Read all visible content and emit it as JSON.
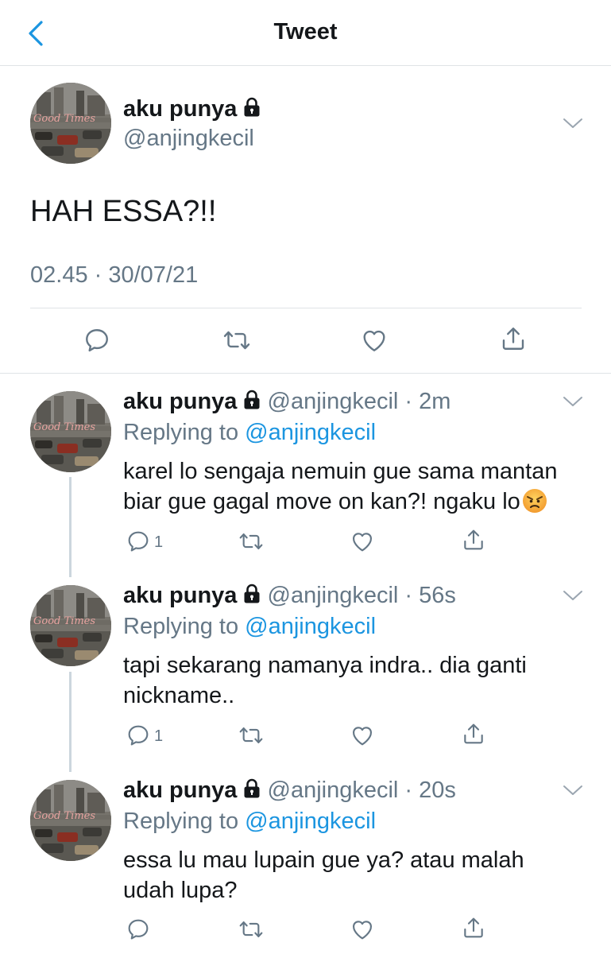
{
  "header": {
    "title": "Tweet"
  },
  "main_tweet": {
    "name": "aku punya",
    "handle": "@anjingkecil",
    "text": "HAH ESSA?!!",
    "timestamp": "02.45 · 30/07/21"
  },
  "replies": [
    {
      "name": "aku punya",
      "handle": "@anjingkecil",
      "time": "2m",
      "replying_prefix": "Replying to",
      "replying_handle": "@anjingkecil",
      "text_line1": "karel lo sengaja nemuin gue sama mantan",
      "text_line2": "biar gue gagal move on kan?! ngaku lo",
      "emoji": "angry-face",
      "reply_count": "1"
    },
    {
      "name": "aku punya",
      "handle": "@anjingkecil",
      "time": "56s",
      "replying_prefix": "Replying to",
      "replying_handle": "@anjingkecil",
      "text_line1": "tapi sekarang namanya indra.. dia ganti",
      "text_line2": "nickname..",
      "reply_count": "1"
    },
    {
      "name": "aku punya",
      "handle": "@anjingkecil",
      "time": "20s",
      "replying_prefix": "Replying to",
      "replying_handle": "@anjingkecil",
      "text_line1": "essa lu mau lupain gue ya? atau malah",
      "text_line2": "udah lupa?"
    }
  ],
  "avatar_caption": "Good Times",
  "colors": {
    "link": "#1b95e0",
    "muted": "#657786",
    "text": "#14171a",
    "divider": "#dfe3e6"
  }
}
